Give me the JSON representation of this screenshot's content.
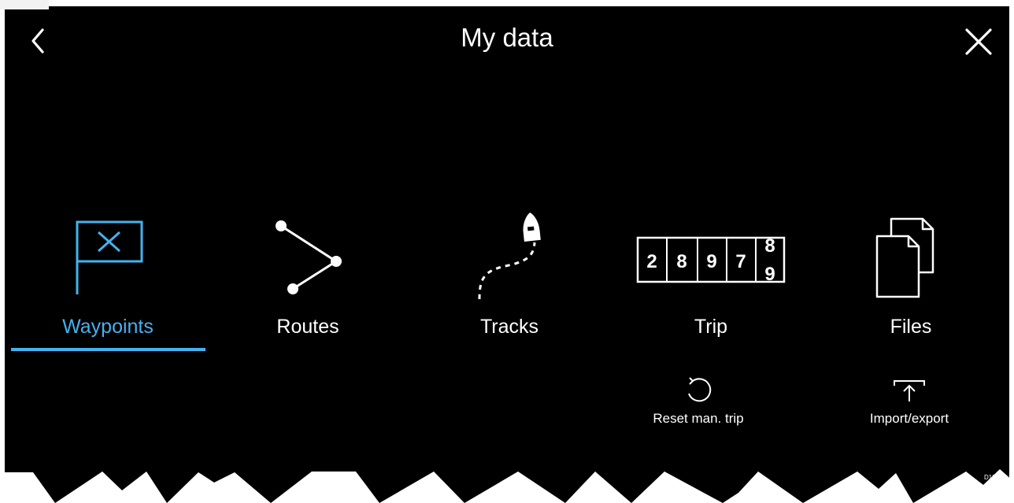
{
  "header": {
    "title": "My data"
  },
  "tabs": [
    {
      "label": "Waypoints",
      "active": true,
      "icon": "waypoint-flag-icon"
    },
    {
      "label": "Routes",
      "active": false,
      "icon": "route-icon"
    },
    {
      "label": "Tracks",
      "active": false,
      "icon": "track-boat-icon"
    },
    {
      "label": "Trip",
      "active": false,
      "icon": "trip-counter-icon"
    },
    {
      "label": "Files",
      "active": false,
      "icon": "files-icon"
    }
  ],
  "trip_counter": {
    "digits": [
      "2",
      "8",
      "9",
      "7"
    ],
    "rolling_top": "8",
    "rolling_bottom": "9"
  },
  "actions": [
    {
      "label": "Reset man. trip",
      "icon": "reset-icon"
    },
    {
      "label": "Import/export",
      "icon": "import-export-icon"
    }
  ],
  "figure_id": "D13691-1",
  "colors": {
    "accent": "#44b2ef",
    "background": "#000000",
    "text": "#ffffff"
  }
}
